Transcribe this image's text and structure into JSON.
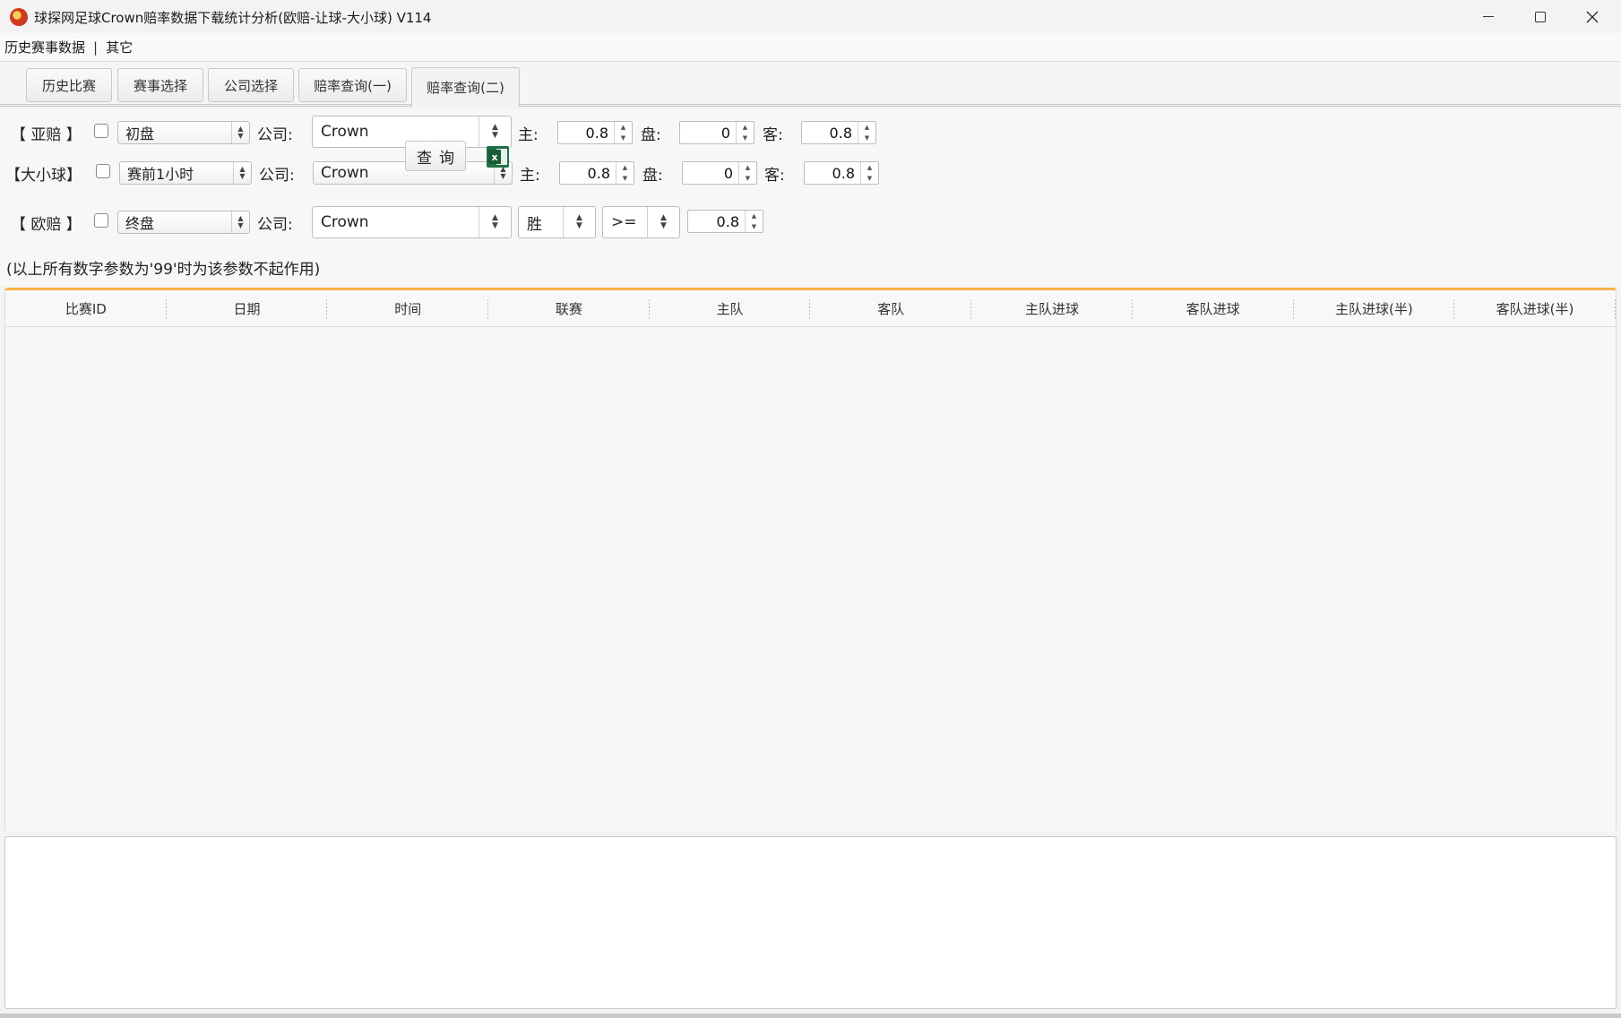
{
  "window": {
    "title": "球探网足球Crown赔率数据下载统计分析(欧赔-让球-大小球) V114"
  },
  "menu": {
    "items": [
      "历史赛事数据",
      "其它"
    ],
    "separator": "|"
  },
  "tabs": [
    {
      "label": "历史比赛",
      "active": false
    },
    {
      "label": "赛事选择",
      "active": false
    },
    {
      "label": "公司选择",
      "active": false
    },
    {
      "label": "赔率查询(一)",
      "active": false
    },
    {
      "label": "赔率查询(二)",
      "active": true
    }
  ],
  "asian": {
    "label": "【 亚赔 】",
    "checked": false,
    "phase": "初盘",
    "company_label": "公司:",
    "company": "Crown",
    "home_label": "主:",
    "home": "0.8",
    "line_label": "盘:",
    "line": "0",
    "away_label": "客:",
    "away": "0.8"
  },
  "overunder": {
    "label": "【大小球】",
    "checked": false,
    "phase": "赛前1小时",
    "company_label": "公司:",
    "company": "Crown",
    "home_label": "主:",
    "home": "0.8",
    "line_label": "盘:",
    "line": "0",
    "away_label": "客:",
    "away": "0.8"
  },
  "european": {
    "label": "【 欧赔 】",
    "checked": false,
    "phase": "终盘",
    "company_label": "公司:",
    "company": "Crown",
    "outcome": "胜",
    "operator": ">=",
    "value": "0.8"
  },
  "hint": "(以上所有数字参数为'99'时为该参数不起作用)",
  "query_button": "查询",
  "export_icon": "excel-icon",
  "table": {
    "columns": [
      "比赛ID",
      "日期",
      "时间",
      "联赛",
      "主队",
      "客队",
      "主队进球",
      "客队进球",
      "主队进球(半)",
      "客队进球(半)"
    ],
    "rows": []
  },
  "colors": {
    "table_accent": "#f5b347",
    "excel_green": "#1e7145"
  }
}
